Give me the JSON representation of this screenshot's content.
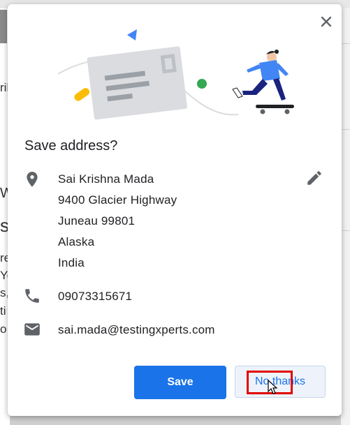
{
  "background": {
    "fragments": [
      "ril",
      "W",
      "s",
      "re",
      "Yo",
      "s,",
      "ti",
      "o"
    ]
  },
  "dialog": {
    "title": "Save address?",
    "address": {
      "name": "Sai Krishna Mada",
      "street": "9400 Glacier Highway",
      "city_zip": "Juneau 99801",
      "state": "Alaska",
      "country": "India"
    },
    "phone": "09073315671",
    "email": "sai.mada@testingxperts.com",
    "buttons": {
      "save": "Save",
      "no_thanks": "No thanks"
    },
    "icons": {
      "close": "close-icon",
      "location": "location-pin-icon",
      "edit": "pencil-icon",
      "phone": "phone-icon",
      "email": "envelope-icon"
    }
  },
  "colors": {
    "primary": "#1a73e8",
    "highlight": "#e00000",
    "icon": "#5f6368"
  }
}
